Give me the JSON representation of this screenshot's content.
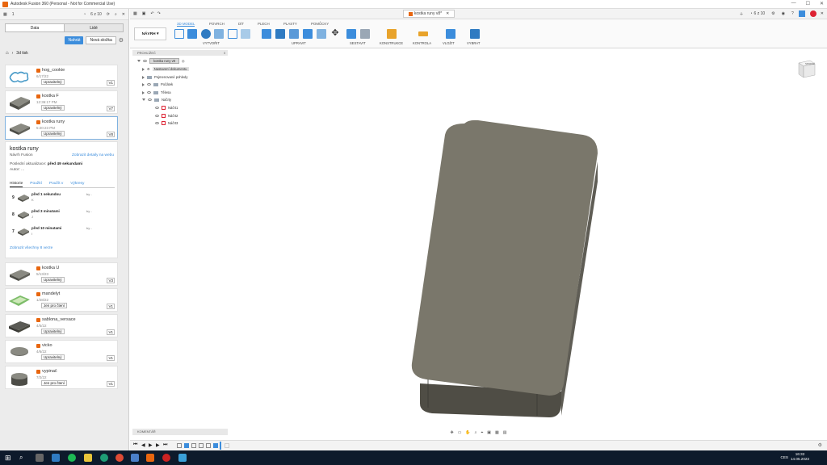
{
  "window": {
    "title": "Autodesk Fusion 360 (Personal - Not for Commercial Use)"
  },
  "left_panel": {
    "top": {
      "user": "1",
      "version_info": "6 z 10"
    },
    "tabs": [
      "Data",
      "Lidé"
    ],
    "actions": {
      "upload": "Nahrát",
      "new_folder": "Nová složka"
    },
    "breadcrumb": "3d tisk",
    "cards": [
      {
        "name": "hog_cookie",
        "date": "6/17/22",
        "perm": "Upravitelný",
        "ver": "V1"
      },
      {
        "name": "kostka F",
        "date": "12:36:17 PM",
        "perm": "Upravitelný",
        "ver": "V7"
      },
      {
        "name": "kostka runy",
        "date": "5:20:23 PM",
        "perm": "Upravitelný",
        "ver": "V8"
      },
      {
        "name": "kostka U",
        "date": "5/13/23",
        "perm": "Upravitelný",
        "ver": "V3"
      },
      {
        "name": "mandelyt",
        "date": "1/28/22",
        "perm": "Jen pro čtení",
        "ver": "V1"
      },
      {
        "name": "sablona_versace",
        "date": "4/5/22",
        "perm": "Upravitelný",
        "ver": "V1"
      },
      {
        "name": "vicko",
        "date": "4/6/22",
        "perm": "Upravitelný",
        "ver": "V1"
      },
      {
        "name": "vypinač",
        "date": "7/2/22",
        "perm": "Jen pro čtení",
        "ver": "V1"
      }
    ],
    "detail": {
      "title": "kostka runy",
      "type": "Návrh Fusion",
      "link": "Zobrazit detaily na webu",
      "save_label": "Poslední aktualizace:",
      "save_value": "před 49 sekundami",
      "author_label": "Autor:",
      "author_value": "...",
      "tabs": [
        "Historie",
        "Použití",
        "Použít v",
        "Výkresy"
      ],
      "history": [
        {
          "num": "9",
          "time": "před 1 sekundou",
          "kind": "K",
          "by": "by -"
        },
        {
          "num": "8",
          "time": "před 3 minutami",
          "kind": "J",
          "by": "by -"
        },
        {
          "num": "7",
          "time": "před 10 minutami",
          "kind": "I",
          "by": "by -"
        }
      ],
      "all_versions": "Zobrazit všechny 8 verze"
    }
  },
  "topbar": {
    "version_info": "6 z 10",
    "doc_tab": "kostka runy v8*"
  },
  "toolbar": {
    "tabs": [
      "3D MODEL",
      "POVRCH",
      "DÍT",
      "PLECH",
      "PLASTY",
      "POMŮCKY"
    ],
    "navrh": "NÁVRH",
    "groups": [
      "VYTVOŘIT",
      "UPRAVIT",
      "SESTAVIT",
      "KONSTRUKCE",
      "KONTROLA",
      "VLOŽIT",
      "VYBRAT"
    ]
  },
  "browser": {
    "header": "PROHLÍŽEČ",
    "root": "kostka runy v8",
    "items": [
      "Nastavení dokumentu",
      "Pojmenované pohledy",
      "Počátek",
      "Tělesa",
      "Náčrty",
      "Náčrt1",
      "Náčrt2",
      "Náčrt3"
    ]
  },
  "viewcube": {
    "label": "SPODNÍ"
  },
  "comments": "KOMENTÁŘ",
  "taskbar": {
    "lang": "CES",
    "time": "16:32",
    "date": "14.05.2023"
  },
  "colors": {
    "accent": "#3c8ddc",
    "brand": "#e8660f",
    "model": "#7a776b"
  }
}
